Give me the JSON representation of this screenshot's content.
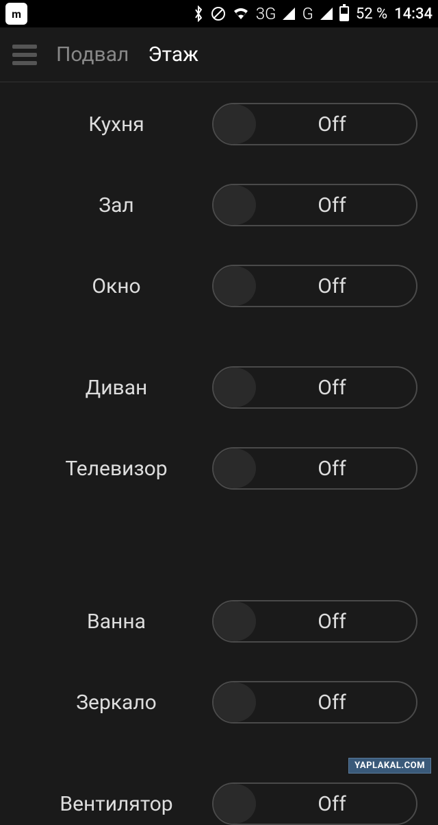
{
  "status_bar": {
    "mi_label": "m",
    "network_3g": "3G",
    "network_g": "G",
    "battery_percent": "52 %",
    "time": "14:34"
  },
  "nav": {
    "tabs": [
      {
        "label": "Подвал",
        "active": false
      },
      {
        "label": "Этаж",
        "active": true
      }
    ]
  },
  "switches": [
    {
      "label": "Кухня",
      "state": "Off",
      "gap": "normal"
    },
    {
      "label": "Зал",
      "state": "Off",
      "gap": "normal"
    },
    {
      "label": "Окно",
      "state": "Off",
      "gap": "section"
    },
    {
      "label": "Диван",
      "state": "Off",
      "gap": "normal"
    },
    {
      "label": "Телевизор",
      "state": "Off",
      "gap": "large"
    },
    {
      "label": "Ванна",
      "state": "Off",
      "gap": "normal"
    },
    {
      "label": "Зеркало",
      "state": "Off",
      "gap": "section"
    },
    {
      "label": "Вентилятор",
      "state": "Off",
      "gap": "normal"
    }
  ],
  "watermark": "YAPLAKAL.COM"
}
